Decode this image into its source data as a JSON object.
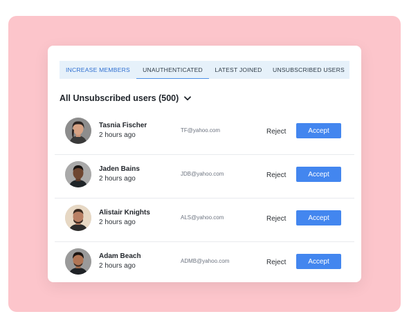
{
  "tabs": [
    {
      "label": "INCREASE MEMBERS"
    },
    {
      "label": "UNAUTHENTICATED"
    },
    {
      "label": "LATEST JOINED"
    },
    {
      "label": "UNSUBSCRIBED USERS"
    }
  ],
  "heading": "All Unsubscribed users (500)",
  "users": [
    {
      "name": "Tasnia Fischer",
      "time": "2 hours ago",
      "email": "TF@yahoo.com",
      "reject": "Reject",
      "accept": "Accept"
    },
    {
      "name": "Jaden Bains",
      "time": "2 hours ago",
      "email": "JDB@yahoo.com",
      "reject": "Reject",
      "accept": "Accept"
    },
    {
      "name": "Alistair Knights",
      "time": "2 hours ago",
      "email": "ALS@yahoo.com",
      "reject": "Reject",
      "accept": "Accept"
    },
    {
      "name": "Adam Beach",
      "time": "2 hours ago",
      "email": "ADMB@yahoo.com",
      "reject": "Reject",
      "accept": "Accept"
    }
  ],
  "colors": {
    "backdrop": "#fcc5cb",
    "tab_bar": "#e6f1fa",
    "active_tab_text": "#2f6fd0",
    "accept_button": "#4386ef"
  },
  "icons": {
    "dropdown": "chevron-down-icon"
  }
}
